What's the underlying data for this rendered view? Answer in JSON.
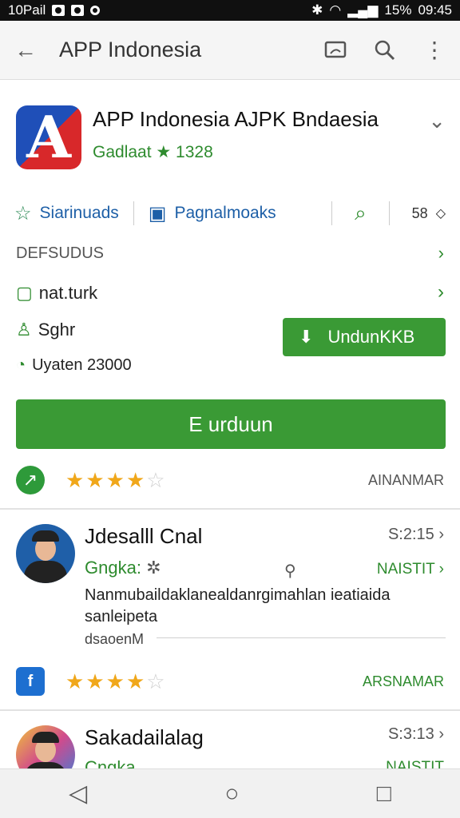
{
  "status_bar": {
    "left_text": "10Pail",
    "battery": "15%",
    "time": "09:45"
  },
  "toolbar": {
    "title": "APP Indonesia"
  },
  "app": {
    "logo_letter": "A",
    "name": "APP Indonesia  AJPK Bndaesia",
    "meta": "Gadlaat ★ 1328"
  },
  "tabs": [
    {
      "label": "Siarinuads"
    },
    {
      "label": "Pagnalmoaks"
    }
  ],
  "tabs_right": {
    "count": "58"
  },
  "section": {
    "label": "DEFSUDUS"
  },
  "lines": {
    "line1": "nat.turk",
    "line2": "Sghr",
    "line3": "Uyaten 23000"
  },
  "buttons": {
    "download_small": "UndunKKB",
    "download_big": "E urduun"
  },
  "rating_rows": [
    {
      "link": "AINANMAR",
      "rating": 3.5
    },
    {
      "link": "ARSNAMAR",
      "rating": 3.5
    }
  ],
  "reviews": [
    {
      "name": "Jdesalll Cnal",
      "time": "S:2:15",
      "sub": "Gngka:",
      "link": "NAISTIT",
      "text": "Nanmubaildaklanealdanrgimahlan ieatiaida sanleipeta",
      "more": "dsaoenM"
    },
    {
      "name": "Sakadailalag",
      "time": "S:3:13",
      "sub": "Cngka",
      "link": "NAISTIT"
    }
  ]
}
